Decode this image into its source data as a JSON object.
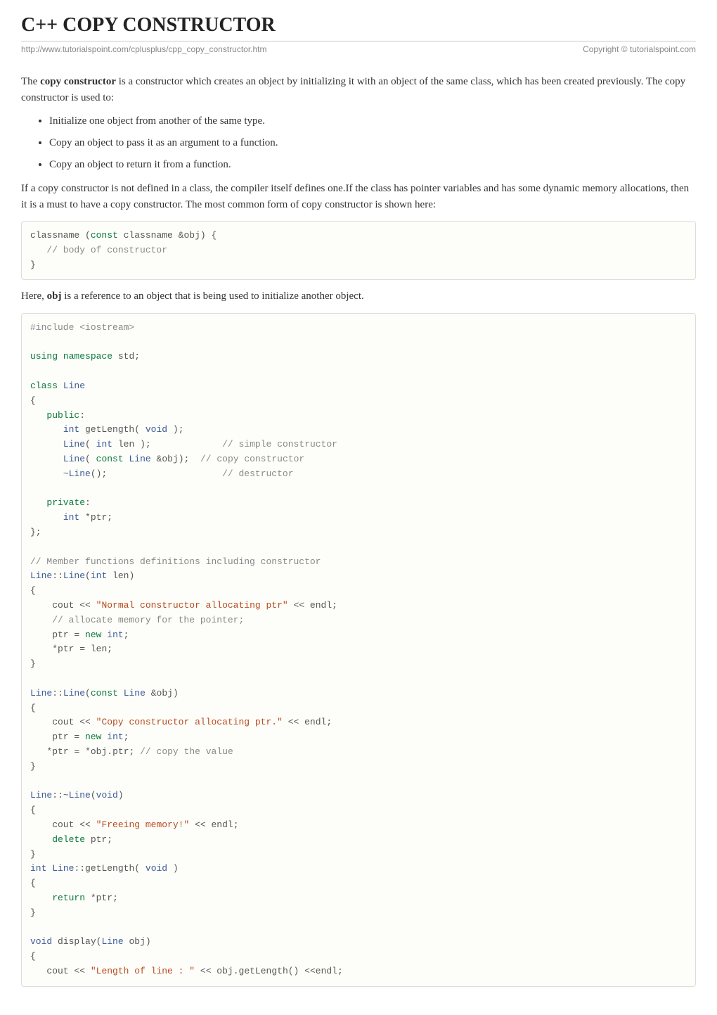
{
  "title": "C++ COPY CONSTRUCTOR",
  "meta": {
    "url": "http://www.tutorialspoint.com/cplusplus/cpp_copy_constructor.htm",
    "copyright": "Copyright © tutorialspoint.com"
  },
  "intro1_pre": "The ",
  "intro1_bold": "copy constructor",
  "intro1_post": " is a constructor which creates an object by initializing it with an object of the same class, which has been created previously. The copy constructor is used to:",
  "bullets": [
    "Initialize one object from another of the same type.",
    "Copy an object to pass it as an argument to a function.",
    "Copy an object to return it from a function."
  ],
  "para2": "If a copy constructor is not defined in a class, the compiler itself defines one.If the class has pointer variables and has some dynamic memory allocations, then it is a must to have a copy constructor. The most common form of copy constructor is shown here:",
  "code1": {
    "line1a": "classname ",
    "line1b": "(",
    "line1c": "const",
    "line1d": " classname ",
    "line1e": "&",
    "line1f": "obj",
    "line1g": ")",
    "line1h": " {",
    "line2": "   // body of constructor",
    "line3": "}"
  },
  "para3_pre": "Here, ",
  "para3_bold": "obj",
  "para3_post": " is a reference to an object that is being used to initialize another object.",
  "code2": {
    "l01": "#include <iostream>",
    "l02_a": "using",
    "l02_b": " ",
    "l02_c": "namespace",
    "l02_d": " std",
    "l02_e": ";",
    "l03_a": "class",
    "l03_b": " ",
    "l03_c": "Line",
    "l04": "{",
    "l05_a": "   ",
    "l05_b": "public",
    "l05_c": ":",
    "l06_a": "      ",
    "l06_b": "int",
    "l06_c": " getLength",
    "l06_d": "(",
    "l06_e": " ",
    "l06_f": "void",
    "l06_g": " ",
    "l06_h": ")",
    "l06_i": ";",
    "l07_a": "      ",
    "l07_b": "Line",
    "l07_c": "(",
    "l07_d": " ",
    "l07_e": "int",
    "l07_f": " len ",
    "l07_g": ")",
    "l07_h": ";",
    "l07_i": "             ",
    "l07_j": "// simple constructor",
    "l08_a": "      ",
    "l08_b": "Line",
    "l08_c": "(",
    "l08_d": " ",
    "l08_e": "const",
    "l08_f": " ",
    "l08_g": "Line",
    "l08_h": " ",
    "l08_i": "&",
    "l08_j": "obj",
    "l08_k": ")",
    "l08_l": ";",
    "l08_m": "  ",
    "l08_n": "// copy constructor",
    "l09_a": "      ",
    "l09_b": "~",
    "l09_c": "Line",
    "l09_d": "()",
    "l09_e": ";",
    "l09_f": "                     ",
    "l09_g": "// destructor",
    "l10": "",
    "l11_a": "   ",
    "l11_b": "private",
    "l11_c": ":",
    "l12_a": "      ",
    "l12_b": "int",
    "l12_c": " ",
    "l12_d": "*",
    "l12_e": "ptr",
    "l12_f": ";",
    "l13": "};",
    "l14": "",
    "l15": "// Member functions definitions including constructor",
    "l16_a": "Line",
    "l16_b": "::",
    "l16_c": "Line",
    "l16_d": "(",
    "l16_e": "int",
    "l16_f": " len",
    "l16_g": ")",
    "l17": "{",
    "l18_a": "    cout ",
    "l18_b": "<<",
    "l18_c": " ",
    "l18_d": "\"Normal constructor allocating ptr\"",
    "l18_e": " ",
    "l18_f": "<<",
    "l18_g": " endl",
    "l18_h": ";",
    "l19": "    // allocate memory for the pointer;",
    "l20_a": "    ptr ",
    "l20_b": "=",
    "l20_c": " ",
    "l20_d": "new",
    "l20_e": " ",
    "l20_f": "int",
    "l20_g": ";",
    "l21_a": "    ",
    "l21_b": "*",
    "l21_c": "ptr ",
    "l21_d": "=",
    "l21_e": " len",
    "l21_f": ";",
    "l22": "}",
    "l23": "",
    "l24_a": "Line",
    "l24_b": "::",
    "l24_c": "Line",
    "l24_d": "(",
    "l24_e": "const",
    "l24_f": " ",
    "l24_g": "Line",
    "l24_h": " ",
    "l24_i": "&",
    "l24_j": "obj",
    "l24_k": ")",
    "l25": "{",
    "l26_a": "    cout ",
    "l26_b": "<<",
    "l26_c": " ",
    "l26_d": "\"Copy constructor allocating ptr.\"",
    "l26_e": " ",
    "l26_f": "<<",
    "l26_g": " endl",
    "l26_h": ";",
    "l27_a": "    ptr ",
    "l27_b": "=",
    "l27_c": " ",
    "l27_d": "new",
    "l27_e": " ",
    "l27_f": "int",
    "l27_g": ";",
    "l28_a": "   ",
    "l28_b": "*",
    "l28_c": "ptr ",
    "l28_d": "=",
    "l28_e": " ",
    "l28_f": "*",
    "l28_g": "obj",
    "l28_h": ".",
    "l28_i": "ptr",
    "l28_j": ";",
    "l28_k": " ",
    "l28_l": "// copy the value",
    "l29": "}",
    "l30": "",
    "l31_a": "Line",
    "l31_b": "::~",
    "l31_c": "Line",
    "l31_d": "(",
    "l31_e": "void",
    "l31_f": ")",
    "l32": "{",
    "l33_a": "    cout ",
    "l33_b": "<<",
    "l33_c": " ",
    "l33_d": "\"Freeing memory!\"",
    "l33_e": " ",
    "l33_f": "<<",
    "l33_g": " endl",
    "l33_h": ";",
    "l34_a": "    ",
    "l34_b": "delete",
    "l34_c": " ptr",
    "l34_d": ";",
    "l35": "}",
    "l36_a": "int",
    "l36_b": " ",
    "l36_c": "Line",
    "l36_d": "::",
    "l36_e": "getLength",
    "l36_f": "(",
    "l36_g": " ",
    "l36_h": "void",
    "l36_i": " ",
    "l36_j": ")",
    "l37": "{",
    "l38_a": "    ",
    "l38_b": "return",
    "l38_c": " ",
    "l38_d": "*",
    "l38_e": "ptr",
    "l38_f": ";",
    "l39": "}",
    "l40": "",
    "l41_a": "void",
    "l41_b": " display",
    "l41_c": "(",
    "l41_d": "Line",
    "l41_e": " obj",
    "l41_f": ")",
    "l42": "{",
    "l43_a": "   cout ",
    "l43_b": "<<",
    "l43_c": " ",
    "l43_d": "\"Length of line : \"",
    "l43_e": " ",
    "l43_f": "<<",
    "l43_g": " obj",
    "l43_h": ".",
    "l43_i": "getLength",
    "l43_j": "()",
    "l43_k": " ",
    "l43_l": "<<",
    "l43_m": "endl",
    "l43_n": ";"
  }
}
